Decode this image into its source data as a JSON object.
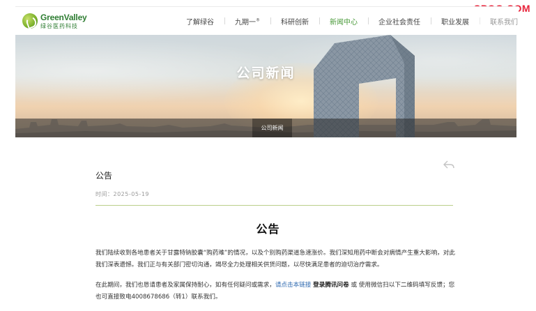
{
  "watermark": "CPQG.COM",
  "logo": {
    "name_en": "GreenValley",
    "name_cn": "绿谷医药科技"
  },
  "nav": {
    "items": [
      {
        "label": "了解绿谷",
        "active": false
      },
      {
        "label": "九期一",
        "sup": "®",
        "active": false
      },
      {
        "label": "科研创新",
        "active": false
      },
      {
        "label": "新闻中心",
        "active": true
      },
      {
        "label": "企业社会责任",
        "active": false
      },
      {
        "label": "职业发展",
        "active": false
      },
      {
        "label": "联系我们",
        "active": false
      }
    ],
    "active_color": "#4a9a3a"
  },
  "banner": {
    "title": "公司新闻",
    "tab": "公司新闻"
  },
  "article": {
    "page_title": "公告",
    "date_label": "时间：",
    "date": "2025-05-19",
    "heading": "公告",
    "para1": "我们陆续收到各地患者关于甘露特钠胶囊“购药难”的情况，以及个别购药渠道急速涨价。我们深知用药中断会对病情产生重大影响，对此我们深表遗憾。我们正与有关部门密切沟通，竭尽全力处理相关供货问题，以尽快满足患者的迫切治疗需求。",
    "para2_prefix": "在此期间，我们也恳请患者及家属保持耐心，如有任何疑问或需求，",
    "para2_link": "请点击本链接",
    "para2_bold": "登录腾讯问卷",
    "para2_suffix": "或 使用微信扫以下二维码填写反馈；您也可直接致电4008678686（转1）联系我们。",
    "link_color": "#2f6ab0",
    "divider_color": "#b9cf8a"
  },
  "icons": {
    "logo": "leaf-logo-icon",
    "share": "share-arrow-icon"
  }
}
